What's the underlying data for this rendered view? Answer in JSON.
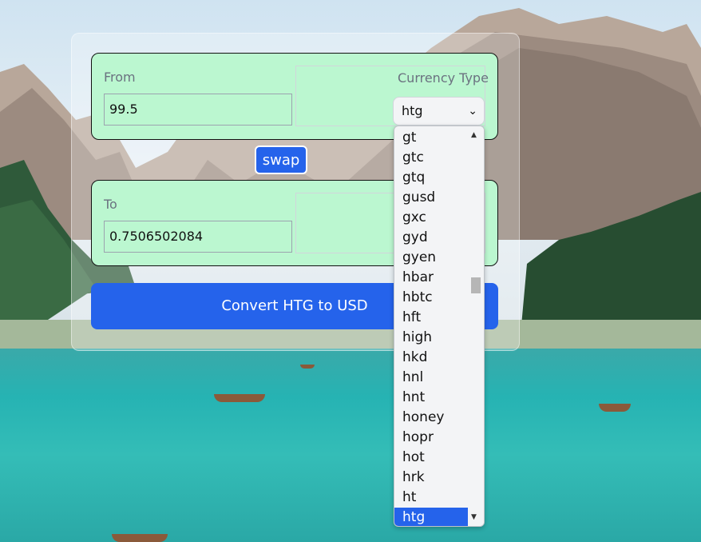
{
  "from": {
    "label": "From",
    "amount": "99.5",
    "currency_label": "Currency Type",
    "currency_selected": "htg"
  },
  "swap_label": "swap",
  "to": {
    "label": "To",
    "amount": "0.7506502084"
  },
  "convert_label": "Convert HTG to USD",
  "dropdown": {
    "options": [
      "gt",
      "gtc",
      "gtq",
      "gusd",
      "gxc",
      "gyd",
      "gyen",
      "hbar",
      "hbtc",
      "hft",
      "high",
      "hkd",
      "hnl",
      "hnt",
      "honey",
      "hopr",
      "hot",
      "hrk",
      "ht",
      "htg"
    ],
    "selected": "htg"
  },
  "icons": {
    "select_chevron": "chevron-down-icon",
    "scroll_up": "scroll-up-arrow-icon",
    "scroll_down": "scroll-down-arrow-icon"
  },
  "colors": {
    "accent": "#2563eb",
    "field_bg": "#bbf7d0"
  }
}
